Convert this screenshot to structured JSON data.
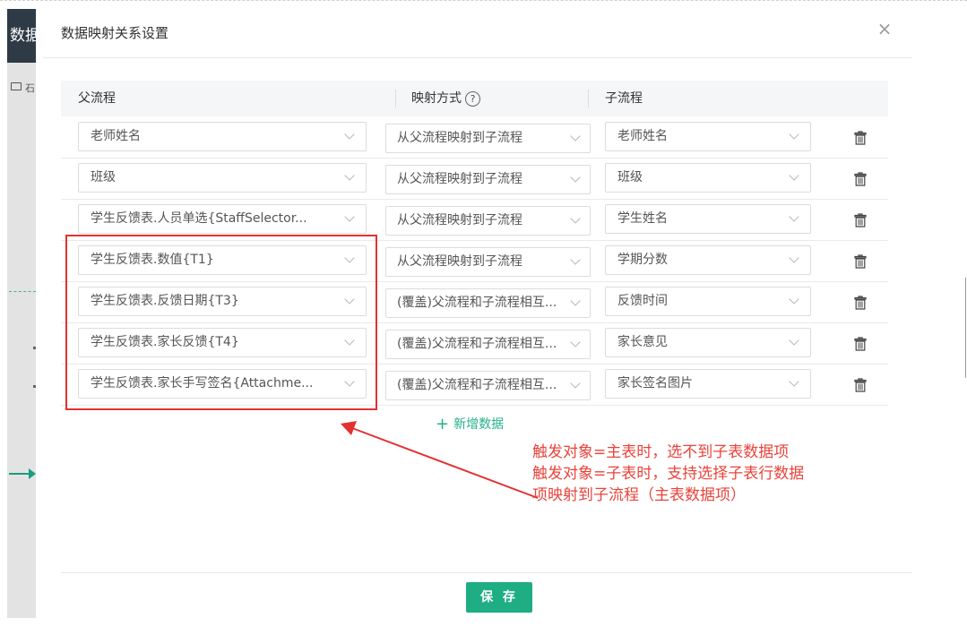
{
  "background": {
    "left_header_text": "数据",
    "left_item_text": "石"
  },
  "modal": {
    "title": "数据映射关系设置",
    "close_symbol": "×",
    "columns": {
      "parent": "父流程",
      "mapping": "映射方式",
      "child": "子流程"
    },
    "help_symbol": "?",
    "rows": [
      {
        "parent": "老师姓名",
        "mapping": "从父流程映射到子流程",
        "child": "老师姓名"
      },
      {
        "parent": "班级",
        "mapping": "从父流程映射到子流程",
        "child": "班级"
      },
      {
        "parent": "学生反馈表.人员单选{StaffSelector...",
        "mapping": "从父流程映射到子流程",
        "child": "学生姓名"
      },
      {
        "parent": "学生反馈表.数值{T1}",
        "mapping": "从父流程映射到子流程",
        "child": "学期分数"
      },
      {
        "parent": "学生反馈表.反馈日期{T3}",
        "mapping": "(覆盖)父流程和子流程相互...",
        "child": "反馈时间"
      },
      {
        "parent": "学生反馈表.家长反馈{T4}",
        "mapping": "(覆盖)父流程和子流程相互...",
        "child": "家长意见"
      },
      {
        "parent": "学生反馈表.家长手写签名{Attachme...",
        "mapping": "(覆盖)父流程和子流程相互...",
        "child": "家长签名图片"
      }
    ],
    "add_label": "新增数据",
    "save_label": "保 存"
  },
  "annotation": {
    "lines": [
      "触发对象=主表时，选不到子表数据项",
      "触发对象=子表时，支持选择子表行数据",
      "项映射到子流程（主表数据项）"
    ],
    "color": "#e53030"
  },
  "colors": {
    "accent": "#1fae84",
    "annotation": "#e53030"
  }
}
